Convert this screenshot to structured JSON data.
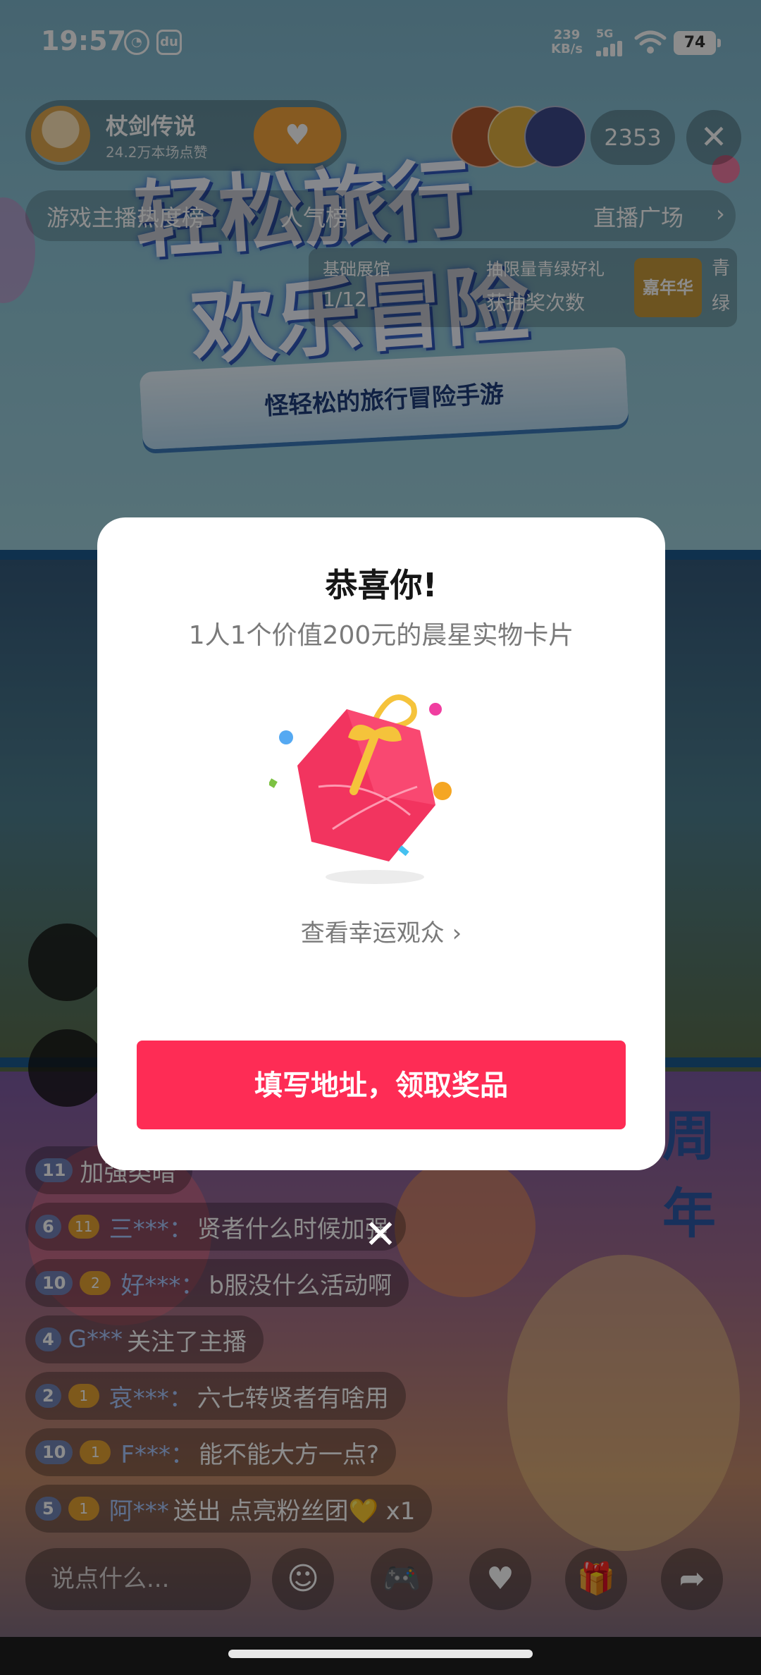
{
  "status_bar": {
    "time": "19:57",
    "net_speed": "239",
    "net_unit": "KB/s",
    "network": "5G",
    "battery": "74"
  },
  "header": {
    "host_name": "杖剑传说",
    "host_likes": "24.2万本场点赞",
    "viewer_count": "2353"
  },
  "ranks": {
    "hot": "游戏主播热度榜",
    "popularity": "人气榜",
    "plaza": "直播广场"
  },
  "task": {
    "left_title": "基础展馆",
    "left_value": "1/12",
    "mid_title": "抽限量青绿好礼",
    "mid_value": "获抽奖次数",
    "badge": "嘉年华",
    "side": "青绿"
  },
  "banner": {
    "line1": "轻松旅行",
    "line2": "欢乐冒险",
    "ribbon": "怪轻松的旅行冒险手游",
    "anniversary": "周年"
  },
  "chat": [
    {
      "level": "11",
      "fan": "",
      "user": "",
      "text": "加强类暗"
    },
    {
      "level": "6",
      "fan": "11",
      "user": "三***：",
      "text": "贤者什么时候加强"
    },
    {
      "level": "10",
      "fan": "2",
      "user": "好***：",
      "text": "b服没什么活动啊"
    },
    {
      "level": "4",
      "fan": "",
      "user": "G***",
      "text": "关注了主播"
    },
    {
      "level": "2",
      "fan": "1",
      "user": "哀***：",
      "text": "六七转贤者有啥用"
    },
    {
      "level": "10",
      "fan": "1",
      "user": "F***：",
      "text": "能不能大方一点?"
    },
    {
      "level": "5",
      "fan": "1",
      "user": "阿***",
      "text": "送出 点亮粉丝团💛 x1"
    }
  ],
  "bottom": {
    "say_placeholder": "说点什么..."
  },
  "modal": {
    "title": "恭喜你!",
    "subtitle": "1人1个价值200元的晨星实物卡片",
    "link": "查看幸运观众 ›",
    "button": "填写地址，领取奖品",
    "close": "✕"
  },
  "colors": {
    "accent": "#fe2c55",
    "gift_red": "#f2345f",
    "gift_gold": "#f5c33b"
  }
}
